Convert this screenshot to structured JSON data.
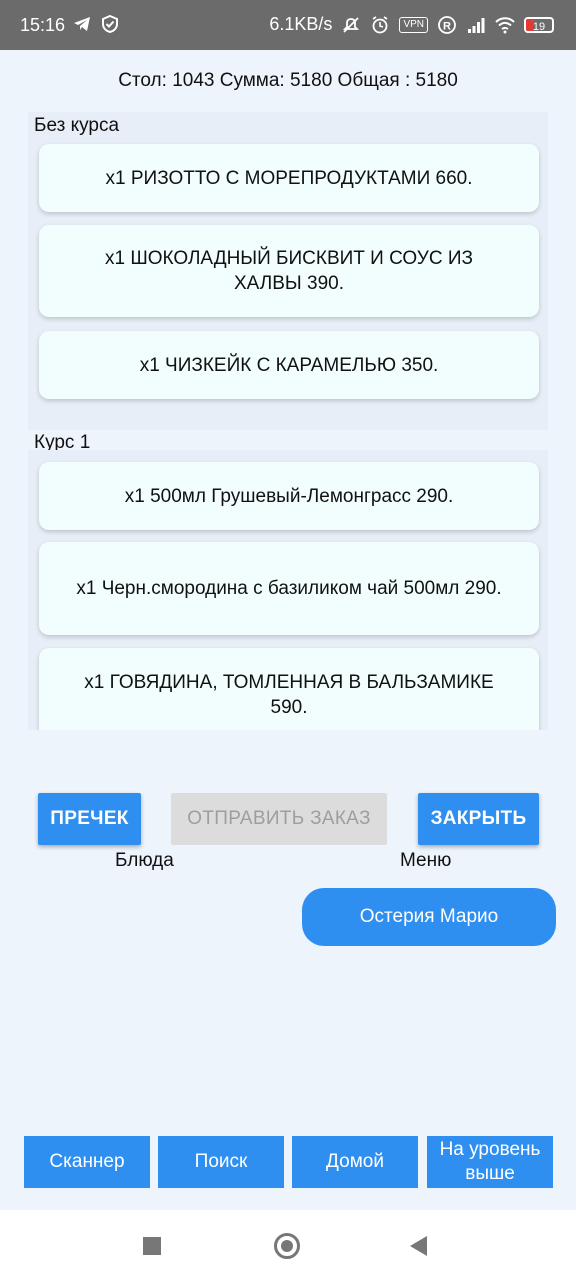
{
  "status_bar": {
    "time": "15:16",
    "net_speed": "6.1KB/s",
    "vpn": "VPN",
    "battery": "19",
    "colors": {
      "bar": "#6b6b6b",
      "battery_low": "#e53935"
    }
  },
  "order_summary": "Стол: 1043 Сумма: 5180 Общая : 5180",
  "groups": [
    {
      "label": "Без курса",
      "items": [
        {
          "text": "x1  РИЗОТТО С МОРЕПРОДУКТАМИ  660."
        },
        {
          "text": "x1  ШОКОЛАДНЫЙ БИСКВИТ И СОУС ИЗ ХАЛВЫ  390."
        },
        {
          "text": "x1  ЧИЗКЕЙК С КАРАМЕЛЬЮ  350."
        }
      ]
    },
    {
      "label": "Курс 1",
      "items": [
        {
          "text": "x1  500мл Грушевый-Лемонграсс  290."
        },
        {
          "text": "x1  Черн.смородина с базиликом чай 500мл 290."
        },
        {
          "text": "x1  ГОВЯДИНА, ТОМЛЕННАЯ В БАЛЬЗАМИКЕ 590."
        }
      ]
    }
  ],
  "actions": {
    "precheck": "ПРЕЧЕК",
    "send_order": "ОТПРАВИТЬ ЗАКАЗ",
    "close": "ЗАКРЫТЬ",
    "dishes_caption": "Блюда",
    "menu_caption": "Меню",
    "restaurant": "Остерия Марио"
  },
  "bottom_nav": {
    "scanner": "Сканнер",
    "search": "Поиск",
    "home": "Домой",
    "up_level": "На уровень выше"
  },
  "colors": {
    "accent": "#2f8ff0",
    "background": "#eef4fc",
    "card": "#f2fdfe",
    "disabled": "#dcdcdc"
  }
}
